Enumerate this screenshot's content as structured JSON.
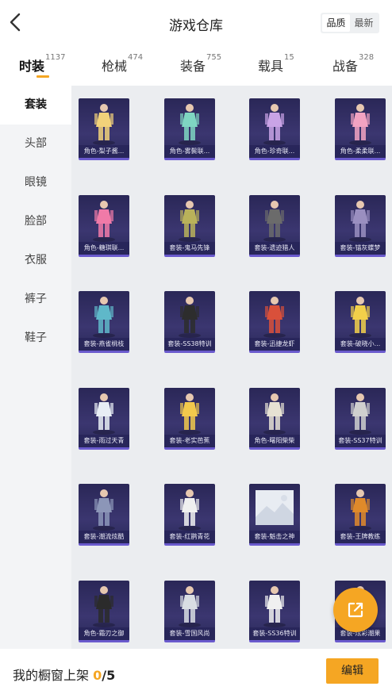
{
  "header": {
    "title": "游戏仓库",
    "back_icon": "chevron-left-icon"
  },
  "sort": {
    "options": [
      "品质",
      "最新"
    ],
    "selected": "品质"
  },
  "tabs": [
    {
      "label": "时装",
      "count": "1137",
      "active": true
    },
    {
      "label": "枪械",
      "count": "474",
      "active": false
    },
    {
      "label": "装备",
      "count": "755",
      "active": false
    },
    {
      "label": "载具",
      "count": "15",
      "active": false
    },
    {
      "label": "战备",
      "count": "328",
      "active": false
    }
  ],
  "sidebar": {
    "items": [
      {
        "label": "套装",
        "active": true
      },
      {
        "label": "头部",
        "active": false
      },
      {
        "label": "眼镜",
        "active": false
      },
      {
        "label": "脸部",
        "active": false
      },
      {
        "label": "衣服",
        "active": false
      },
      {
        "label": "裤子",
        "active": false
      },
      {
        "label": "鞋子",
        "active": false
      }
    ]
  },
  "items": [
    {
      "label": "角色-梨子酱...",
      "color": "#f2d27a"
    },
    {
      "label": "角色-雾鬓联...",
      "color": "#7fd6c2"
    },
    {
      "label": "角色-珍奇联...",
      "color": "#c9a3e6"
    },
    {
      "label": "角色-柔柔联...",
      "color": "#f2a3c2"
    },
    {
      "label": "角色-糖琪联...",
      "color": "#f07aa8"
    },
    {
      "label": "套装-鬼马先锋",
      "color": "#b9b25a"
    },
    {
      "label": "套装-遗迹猎人",
      "color": "#6b6b6b"
    },
    {
      "label": "套装-锚灰蝶梦",
      "color": "#9a8fc0"
    },
    {
      "label": "套装-燕雀桃枝",
      "color": "#5fb8c9"
    },
    {
      "label": "套装-SS38特训",
      "color": "#2d2d2d"
    },
    {
      "label": "套装-迅捷龙虾",
      "color": "#d9503a"
    },
    {
      "label": "套装-破晓小...",
      "color": "#f2d04a"
    },
    {
      "label": "套装-雨过天青",
      "color": "#e8eef5"
    },
    {
      "label": "套装-老实芭蕉",
      "color": "#f2c94c"
    },
    {
      "label": "角色-曙阳柴柴",
      "color": "#e6e1d3"
    },
    {
      "label": "套装-SS37特训",
      "color": "#cfcfcf"
    },
    {
      "label": "套装-潮流炫酷",
      "color": "#8c96b8"
    },
    {
      "label": "套装-红鹊青花",
      "color": "#f0f0f0"
    },
    {
      "label": "套装-魁击之神",
      "color": "",
      "placeholder": true
    },
    {
      "label": "套装-王牌教练",
      "color": "#e08a2a"
    },
    {
      "label": "角色-霜刃之御",
      "color": "#2b2b2b"
    },
    {
      "label": "套装-雪国风尚",
      "color": "#d9dde3"
    },
    {
      "label": "套装-SS36特训",
      "color": "#f0f0f0"
    },
    {
      "label": "套装-炫彩潮果",
      "color": "#f5a623"
    }
  ],
  "fab": {
    "icon": "share-icon"
  },
  "showcase": {
    "label": "我的橱窗上架",
    "used": "0",
    "separator": "/",
    "total": "5"
  },
  "edit_button": {
    "label": "编辑"
  },
  "colors": {
    "accent": "#f5a623",
    "card_bg": "#2f2b63"
  }
}
